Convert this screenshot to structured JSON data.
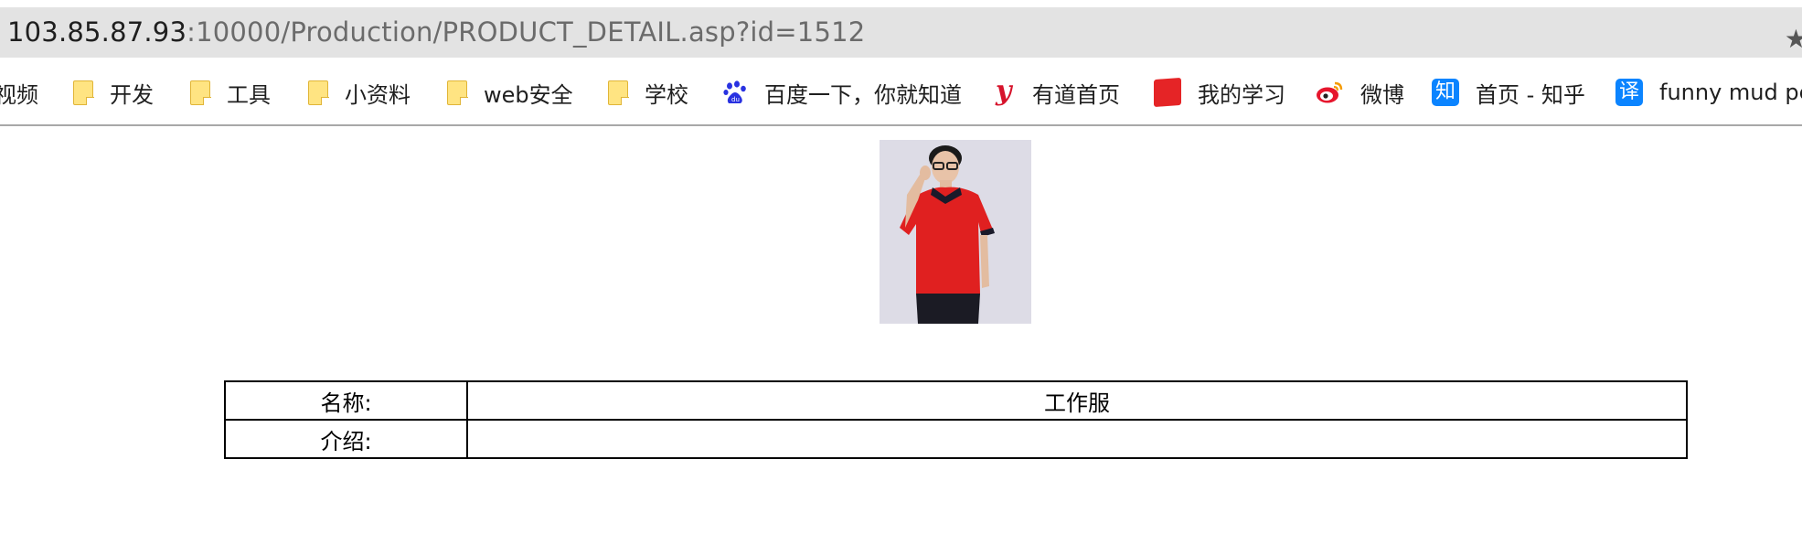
{
  "address_bar": {
    "host": "103.85.87.93",
    "path": ":10000/Production/PRODUCT_DETAIL.asp?id=1512"
  },
  "bookmarks": [
    {
      "label": "视频",
      "icon": "video-folder-icon"
    },
    {
      "label": "开发",
      "icon": "folder-icon"
    },
    {
      "label": "工具",
      "icon": "folder-icon"
    },
    {
      "label": "小资料",
      "icon": "folder-icon"
    },
    {
      "label": "web安全",
      "icon": "folder-icon"
    },
    {
      "label": "学校",
      "icon": "folder-icon"
    },
    {
      "label": "百度一下，你就知道",
      "icon": "baidu-paw-icon"
    },
    {
      "label": "有道首页",
      "icon": "youdao-icon"
    },
    {
      "label": "我的学习",
      "icon": "study-icon"
    },
    {
      "label": "微博",
      "icon": "weibo-icon"
    },
    {
      "label": "首页 - 知乎",
      "icon": "zhihu-icon",
      "glyph": "知"
    },
    {
      "label": "funny mud pe",
      "icon": "translate-icon",
      "glyph": "译"
    }
  ],
  "product": {
    "photo_alt": "product-photo",
    "rows": [
      {
        "label": "名称:",
        "value": "工作服"
      },
      {
        "label": "介绍:",
        "value": ""
      }
    ]
  },
  "colors": {
    "address_bg": "#e3e3e3",
    "folder_yellow": "#ffe482",
    "youdao_red": "#d6132b",
    "study_red": "#e52426",
    "zhihu_blue": "#0b84ff",
    "shirt_red": "#e02020"
  }
}
